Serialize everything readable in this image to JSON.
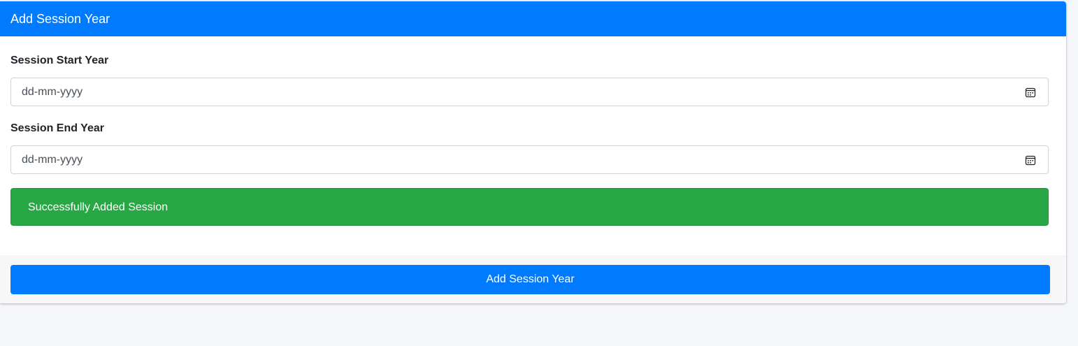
{
  "card": {
    "header_title": "Add Session Year"
  },
  "form": {
    "start_label": "Session Start Year",
    "start_placeholder": "dd-mm-yyyy",
    "end_label": "Session End Year",
    "end_placeholder": "dd-mm-yyyy",
    "calendar_icon": "calendar-icon"
  },
  "alert": {
    "message": "Successfully Added Session",
    "color": "#28a745"
  },
  "footer": {
    "submit_label": "Add Session Year",
    "button_color": "#007bff"
  }
}
